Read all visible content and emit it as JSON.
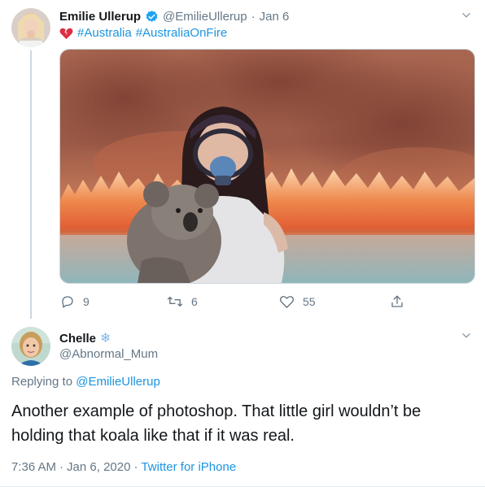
{
  "original_tweet": {
    "display_name": "Emilie Ullerup",
    "handle": "@EmilieUllerup",
    "separator": "·",
    "date": "Jan 6",
    "text_prefix_emoji": "💔",
    "hashtags": [
      "#Australia",
      "#AustraliaOnFire"
    ],
    "actions": {
      "replies": "9",
      "retweets": "6",
      "likes": "55"
    }
  },
  "reply_tweet": {
    "display_name": "Chelle",
    "name_emoji": "❄",
    "handle": "@Abnormal_Mum",
    "replying_prefix": "Replying to",
    "replying_to": "@EmilieUllerup",
    "text": "Another example of photoshop. That little girl wouldn’t be holding that koala like that if it was real.",
    "time": "7:36 AM",
    "date": "Jan 6, 2020",
    "dot": "·",
    "source": "Twitter for iPhone"
  },
  "colors": {
    "link": "#1b95e0",
    "verified": "#1da1f2",
    "muted": "#657786"
  }
}
